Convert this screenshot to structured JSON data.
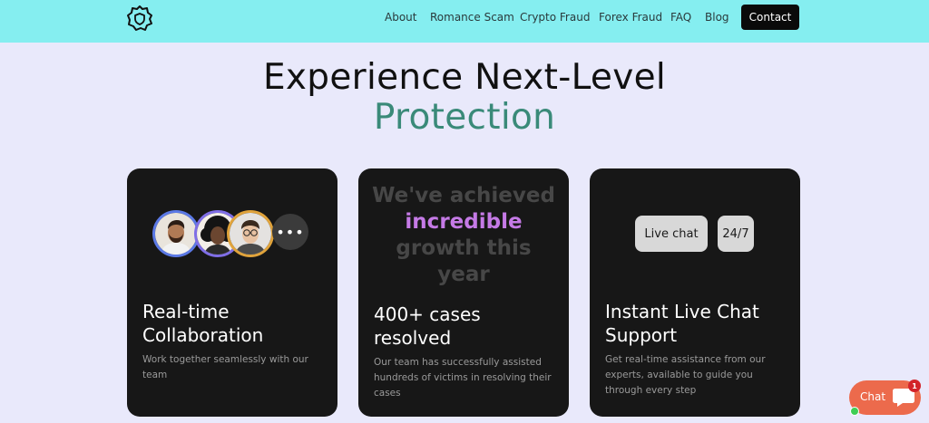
{
  "nav": {
    "logo": "shield-gear-logo-icon",
    "items": [
      "About",
      "Romance Scam",
      "Crypto Fraud",
      "Forex Fraud",
      "FAQ",
      "Blog"
    ],
    "contact_label": "Contact"
  },
  "hero": {
    "headline": "Experience Next-Level",
    "accent": "Protection"
  },
  "cards": [
    {
      "title_line1": "Real-time",
      "title_line2": "Collaboration",
      "desc_line1": "Work together seamlessly with our",
      "desc_line2": "team",
      "avatars": [
        "avatar-man-beard",
        "avatar-woman-curly",
        "avatar-man-glasses"
      ],
      "more": "•••"
    },
    {
      "growth_line1": "We've achieved",
      "growth_highlight": "incredible",
      "growth_line3": "growth this",
      "growth_line4": "year",
      "title_line1": "400+ cases",
      "title_line2": "resolved",
      "desc_line1": "Our team has successfully assisted",
      "desc_line2": "hundreds of victims in resolving their",
      "desc_line3": "cases"
    },
    {
      "chip1": "Live chat",
      "chip2": "24/7",
      "title_line1": "Instant Live Chat",
      "title_line2": "Support",
      "desc_line1": "Get real-time assistance from our",
      "desc_line2": "experts, available to guide you",
      "desc_line3": "through every step"
    }
  ],
  "chat_widget": {
    "label": "Chat",
    "badge": "1",
    "icon": "chat-bubble-icon"
  },
  "colors": {
    "navbar": "#85eef0",
    "background": "#e9e9fb",
    "accent_green": "#3a8a79",
    "card_bg": "#171717",
    "highlight_purple": "#c57ae6",
    "chat_orange": "#ec6a4c"
  }
}
